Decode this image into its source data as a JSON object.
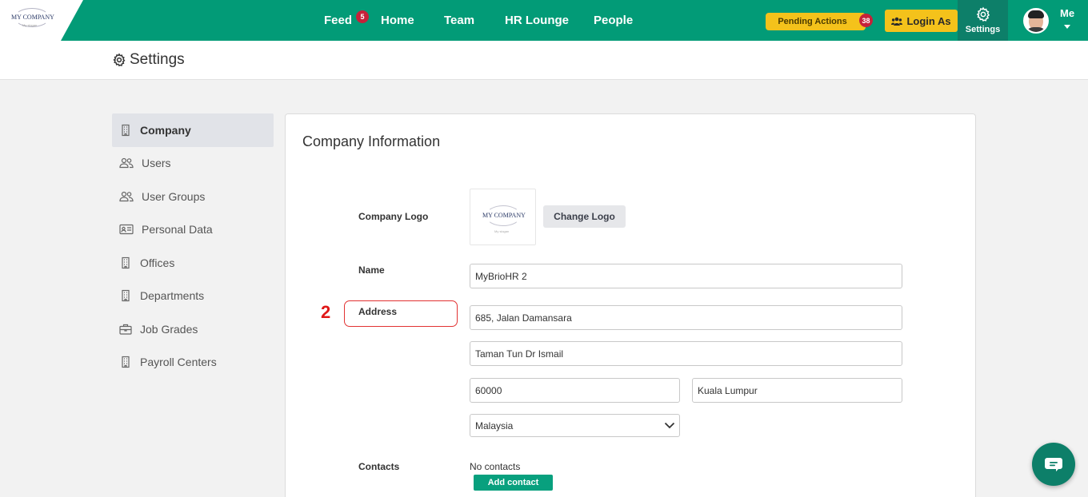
{
  "logo": {
    "name": "MY COMPANY",
    "tagline": "My slogan"
  },
  "nav": {
    "feed": "Feed",
    "feed_badge": "5",
    "home": "Home",
    "team": "Team",
    "hr_lounge": "HR Lounge",
    "people": "People"
  },
  "header_actions": {
    "pending_actions": "Pending Actions",
    "pending_badge": "38",
    "login_as": "Login As",
    "settings": "Settings",
    "me": "Me"
  },
  "page": {
    "title": "Settings"
  },
  "sidebar": {
    "items": [
      {
        "label": "Company",
        "icon": "building-icon",
        "active": true
      },
      {
        "label": "Users",
        "icon": "users-icon"
      },
      {
        "label": "User Groups",
        "icon": "users-icon"
      },
      {
        "label": "Personal Data",
        "icon": "id-card-icon"
      },
      {
        "label": "Offices",
        "icon": "building-icon"
      },
      {
        "label": "Departments",
        "icon": "building-icon"
      },
      {
        "label": "Job Grades",
        "icon": "briefcase-icon"
      },
      {
        "label": "Payroll Centers",
        "icon": "building-icon"
      }
    ]
  },
  "company_info": {
    "title": "Company Information",
    "logo_label": "Company Logo",
    "change_logo": "Change Logo",
    "name_label": "Name",
    "name_value": "MyBrioHR 2",
    "address_label": "Address",
    "address_line1": "685, Jalan Damansara",
    "address_line2": "Taman Tun Dr Ismail",
    "postcode": "60000",
    "city": "Kuala Lumpur",
    "country": "Malaysia",
    "contacts_label": "Contacts",
    "no_contacts": "No contacts",
    "add_contact": "Add contact"
  },
  "annotation": {
    "step": "2"
  },
  "colors": {
    "brand": "#029b77",
    "brand_dark": "#0d7f69",
    "accent": "#f4c21b",
    "badge": "#c6213a",
    "annotation": "#e01818"
  }
}
